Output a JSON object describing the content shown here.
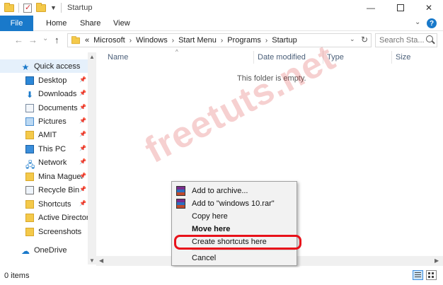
{
  "window": {
    "title": "Startup",
    "minimize_glyph": "—",
    "close_glyph": "✕"
  },
  "ribbon": {
    "tabs": [
      "File",
      "Home",
      "Share",
      "View"
    ]
  },
  "address_bar": {
    "back_glyph": "←",
    "forward_glyph": "→",
    "recent_glyph": "⌄",
    "up_glyph": "↑",
    "overflow_glyph": "«",
    "breadcrumbs": [
      "Microsoft",
      "Windows",
      "Start Menu",
      "Programs",
      "Startup"
    ],
    "separator_glyph": "›",
    "refresh_glyph": "↻",
    "dropdown_glyph": "⌄",
    "search_placeholder": "Search Sta..."
  },
  "nav_pane": {
    "quick_access": {
      "label": "Quick access",
      "icon": "star-icon"
    },
    "items": [
      {
        "label": "Desktop",
        "icon": "desktop-icon",
        "pinned": true
      },
      {
        "label": "Downloads",
        "icon": "download-icon",
        "pinned": true
      },
      {
        "label": "Documents",
        "icon": "documents-icon",
        "pinned": true
      },
      {
        "label": "Pictures",
        "icon": "pictures-icon",
        "pinned": true
      },
      {
        "label": "AMIT",
        "icon": "folder-icon",
        "pinned": true
      },
      {
        "label": "This PC",
        "icon": "computer-icon",
        "pinned": true
      },
      {
        "label": "Network",
        "icon": "network-icon",
        "pinned": true
      },
      {
        "label": "Mina Maguer",
        "icon": "folder-icon",
        "pinned": true
      },
      {
        "label": "Recycle Bin",
        "icon": "recycle-bin-icon",
        "pinned": true
      },
      {
        "label": "Shortcuts",
        "icon": "folder-icon",
        "pinned": true
      },
      {
        "label": "Active Directory",
        "icon": "folder-icon",
        "pinned": false
      },
      {
        "label": "Screenshots",
        "icon": "folder-icon",
        "pinned": false
      }
    ],
    "onedrive": {
      "label": "OneDrive",
      "icon": "cloud-icon"
    },
    "pin_glyph": "📌"
  },
  "content": {
    "columns": [
      "Name",
      "Date modified",
      "Type",
      "Size"
    ],
    "empty_message": "This folder is empty."
  },
  "context_menu": {
    "items": [
      {
        "label": "Add to archive...",
        "icon": "winrar-icon",
        "bold": false
      },
      {
        "label": "Add to \"windows 10.rar\"",
        "icon": "winrar-icon",
        "bold": false
      },
      {
        "label": "Copy here",
        "icon": "",
        "bold": false
      },
      {
        "label": "Move here",
        "icon": "",
        "bold": true
      },
      {
        "label": "Create shortcuts here",
        "icon": "",
        "bold": false,
        "highlighted": true
      },
      {
        "label": "Cancel",
        "icon": "",
        "bold": false
      }
    ],
    "highlight_color": "#e8111a"
  },
  "watermark": {
    "text": "freetuts.net",
    "color": "#d62a2a"
  },
  "status_bar": {
    "item_count": "0 items"
  },
  "colors": {
    "accent": "#1979ca",
    "quick_access_bg": "#e5f0fb",
    "folder": "#f4c94a"
  }
}
